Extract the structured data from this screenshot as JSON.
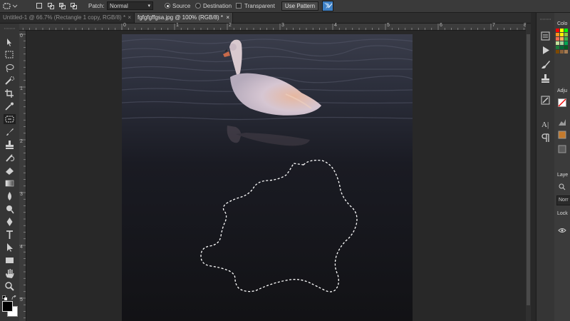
{
  "options_bar": {
    "patch_label": "Patch:",
    "patch_mode": "Normal",
    "source_label": "Source",
    "destination_label": "Destination",
    "transparent_label": "Transparent",
    "use_pattern_label": "Use Pattern",
    "source_selected": true
  },
  "tabs": [
    {
      "label": "Untitled-1 @ 66.7% (Rectangle 1 copy, RGB/8) *",
      "close": "×",
      "active": false
    },
    {
      "label": "fgfgfgffgsa.jpg @ 100% (RGB/8) *",
      "close": "×",
      "active": true
    }
  ],
  "ruler": {
    "h_ticks": [
      "0",
      "1",
      "2",
      "3",
      "4",
      "5",
      "6",
      "7",
      "8"
    ],
    "v_ticks": [
      "0",
      "1",
      "2",
      "3",
      "4",
      "5"
    ]
  },
  "tools": [
    "move-tool",
    "marquee-tool",
    "lasso-tool",
    "quick-select-tool",
    "crop-tool",
    "eyedropper-tool",
    "patch-tool",
    "brush-tool",
    "clone-stamp-tool",
    "history-brush-tool",
    "eraser-tool",
    "gradient-tool",
    "blur-tool",
    "dodge-tool",
    "pen-tool",
    "type-tool",
    "path-select-tool",
    "shape-tool",
    "hand-tool",
    "zoom-tool"
  ],
  "panels": {
    "color_title": "Colo",
    "adjust_title": "Adju",
    "layers_title": "Laye",
    "blend_mode": "Norr",
    "lock_label": "Lock"
  },
  "colors": {
    "foreground": "#000000",
    "background": "#ffffff",
    "accent": "#3d7fc4"
  }
}
